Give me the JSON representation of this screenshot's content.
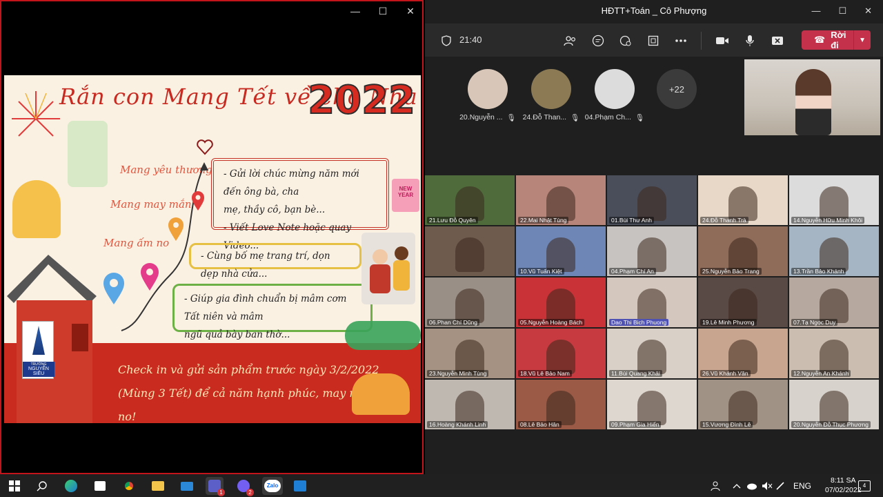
{
  "share_window": {
    "controls": {
      "minimize": "—",
      "maximize": "☐",
      "close": "✕"
    },
    "slide": {
      "title": "Rắn con Mang Tết về cho Nhà",
      "year": "2022",
      "phrases": [
        "Mang yêu thương",
        "Mang may mắn",
        "Mang ấm no"
      ],
      "card_red": [
        "- Gửi lời chúc mừng năm mới đến ông bà, cha",
        "mẹ, thầy cô, bạn bè...",
        "- Viết Love Note hoặc quay Video..."
      ],
      "card_yellow": "- Cùng bố mẹ trang trí, dọn dẹp nhà cửa...",
      "card_green": [
        "- Giúp gia đình chuẩn bị mâm cơm Tất niên và mâm",
        "ngũ quả bày ban thờ..."
      ],
      "banner": [
        "Check in và gửi sản phẩm trước ngày 3/2/2022",
        "(Mùng 3 Tết) để cả năm hạnh phúc, may mắn và ấm no!"
      ],
      "new_year_card": "NEW YEAR",
      "school": {
        "small": "TRƯỜNG",
        "name": "NGUYỄN SIÊU"
      }
    }
  },
  "teams": {
    "title": "HĐTT+Toán _ Cô Phượng",
    "window_controls": {
      "minimize": "—",
      "maximize": "☐",
      "close": "✕"
    },
    "toolbar": {
      "time": "21:40",
      "leave_label": "Rời đi",
      "icons": [
        "shield-icon",
        "people-icon",
        "chat-icon",
        "react-icon",
        "rooms-icon",
        "more-icon",
        "camera-icon",
        "mic-icon",
        "share-icon"
      ]
    },
    "featured": [
      {
        "name": "20.Nguyễn ...",
        "color": "#d8c7b8"
      },
      {
        "name": "24.Đỗ Than...",
        "color": "#8c7a55"
      },
      {
        "name": "04.Phạm Ch...",
        "color": "#dcdcdc"
      }
    ],
    "more_count": "+22",
    "grid": [
      {
        "name": "21.Lưu Đỗ Quyên",
        "bg": "#4f6b3c"
      },
      {
        "name": "22.Mai Nhật Tùng",
        "bg": "#b8857a"
      },
      {
        "name": "01.Bùi Thư Anh",
        "bg": "#4a4e5a"
      },
      {
        "name": "24.Đỗ Thanh Trà",
        "bg": "#e7d8c8"
      },
      {
        "name": "14.Nguyễn Hữu Minh Khôi",
        "bg": "#dcdcdc"
      },
      {
        "name": "",
        "bg": "#6f5a4e"
      },
      {
        "name": "10.Vũ Tuấn Kiệt",
        "bg": "#6d86b6"
      },
      {
        "name": "04.Phạm Chí An",
        "bg": "#c7c3c0"
      },
      {
        "name": "25.Nguyễn Bảo Trang",
        "bg": "#8f6b5a"
      },
      {
        "name": "13.Trần Bảo Khánh",
        "bg": "#a6b5c3"
      },
      {
        "name": "06.Phan Chí Dũng",
        "bg": "#9a8f86"
      },
      {
        "name": "05.Nguyễn Hoàng Bách",
        "bg": "#c93236"
      },
      {
        "name": "Dao Thi Bich Phuong",
        "bg": "#d4c7bd"
      },
      {
        "name": "19.Lê Minh Phương",
        "bg": "#5a4a45"
      },
      {
        "name": "07.Tạ Ngọc Duy",
        "bg": "#b6a89e"
      },
      {
        "name": "23.Nguyễn Minh Tùng",
        "bg": "#a59282"
      },
      {
        "name": "18.Vũ Lê Bảo Nam",
        "bg": "#c73a3f"
      },
      {
        "name": "11.Bùi Quang Khải",
        "bg": "#d9d1c7"
      },
      {
        "name": "26.Vũ Khánh Vân",
        "bg": "#c8a58e"
      },
      {
        "name": "12.Nguyễn An Khánh",
        "bg": "#cbbdaf"
      },
      {
        "name": "16.Hoàng Khánh Linh",
        "bg": "#bfb8b0"
      },
      {
        "name": "08.Lê Bảo Hân",
        "bg": "#9a5a45"
      },
      {
        "name": "09.Phạm Gia Hiển",
        "bg": "#ddd7d0"
      },
      {
        "name": "15.Vương Đình Lê",
        "bg": "#a09284"
      },
      {
        "name": "20.Nguyễn Đỗ Thục Phương",
        "bg": "#d7d2cc"
      }
    ]
  },
  "taskbar": {
    "apps": [
      "windows-icon",
      "search-icon",
      "edge-icon",
      "store-icon",
      "chrome-icon",
      "explorer-icon",
      "mail-icon",
      "teams-icon",
      "viber-icon",
      "zalo-icon",
      "media-icon"
    ],
    "teams_badge": "1",
    "viber_badge": "2",
    "zalo_label": "Zalo",
    "language": "ENG",
    "time": "8:11 SA",
    "date": "07/02/2022",
    "notification_count": "4"
  }
}
